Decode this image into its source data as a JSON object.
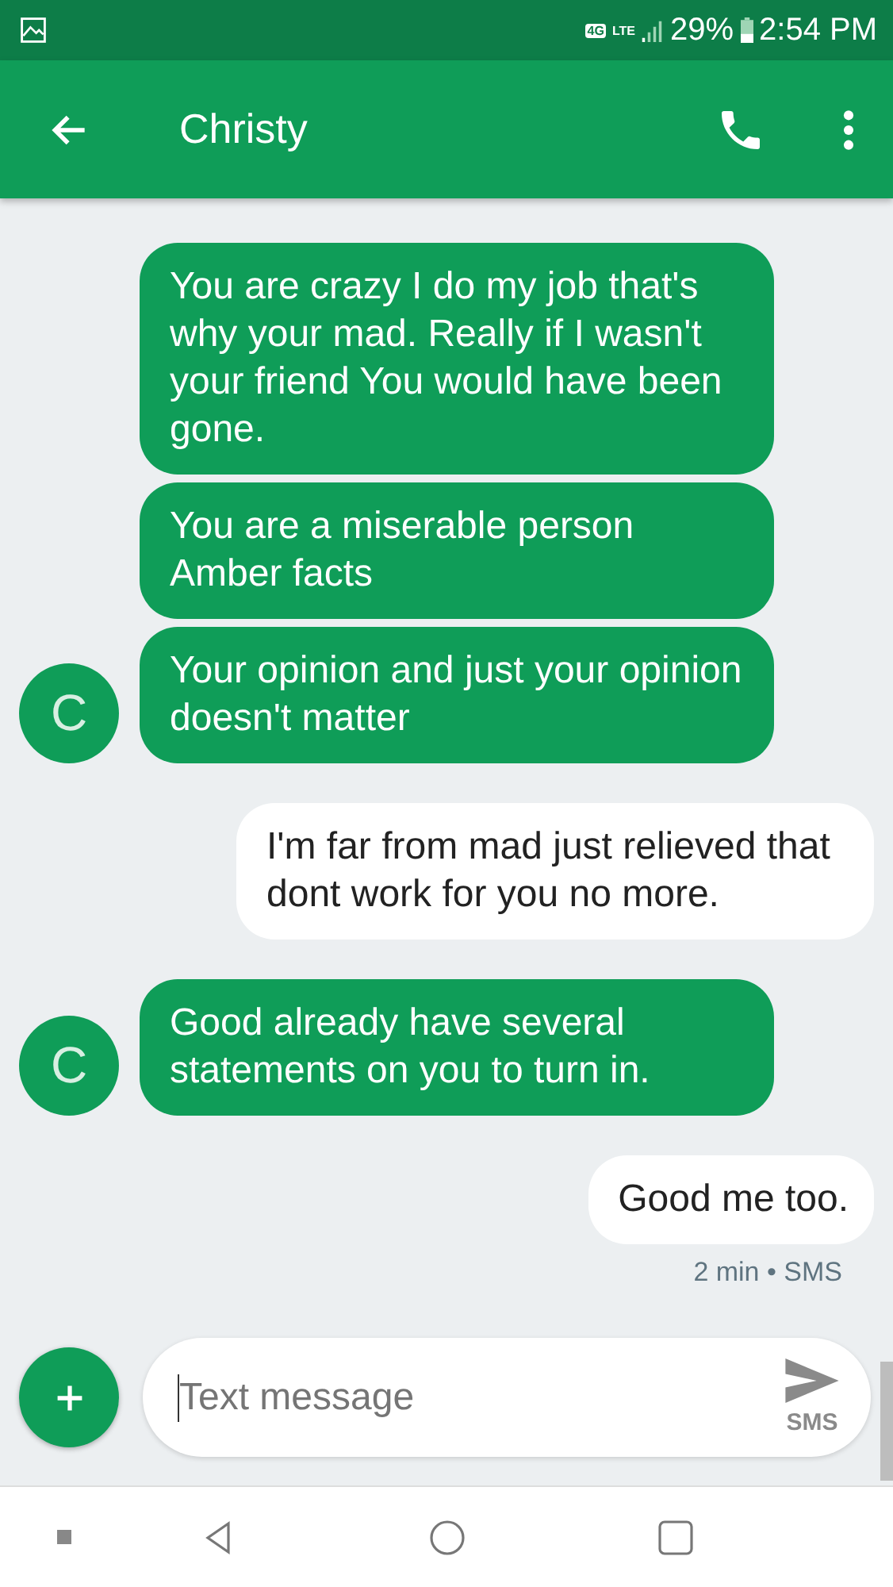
{
  "status_bar": {
    "network": "4G",
    "signal_label": "LTE",
    "battery": "29%",
    "time": "2:54 PM"
  },
  "app_bar": {
    "title": "Christy"
  },
  "messages": [
    {
      "kind": "incoming",
      "text": "You are crazy I do my job that's why your mad. Really if I wasn't your friend You would have been gone."
    },
    {
      "kind": "incoming",
      "text": "You are a miserable person Amber facts"
    },
    {
      "kind": "incoming",
      "text": "Your opinion and just your opinion doesn't matter",
      "avatar": "C"
    },
    {
      "kind": "outgoing",
      "text": "I'm far from mad just relieved that dont work for you no more."
    },
    {
      "kind": "incoming",
      "text": "Good already have several statements on you to turn in.",
      "avatar": "C"
    },
    {
      "kind": "outgoing",
      "text": "Good me too.",
      "meta": "2 min • SMS"
    }
  ],
  "composer": {
    "placeholder": "Text message",
    "send_label": "SMS"
  }
}
